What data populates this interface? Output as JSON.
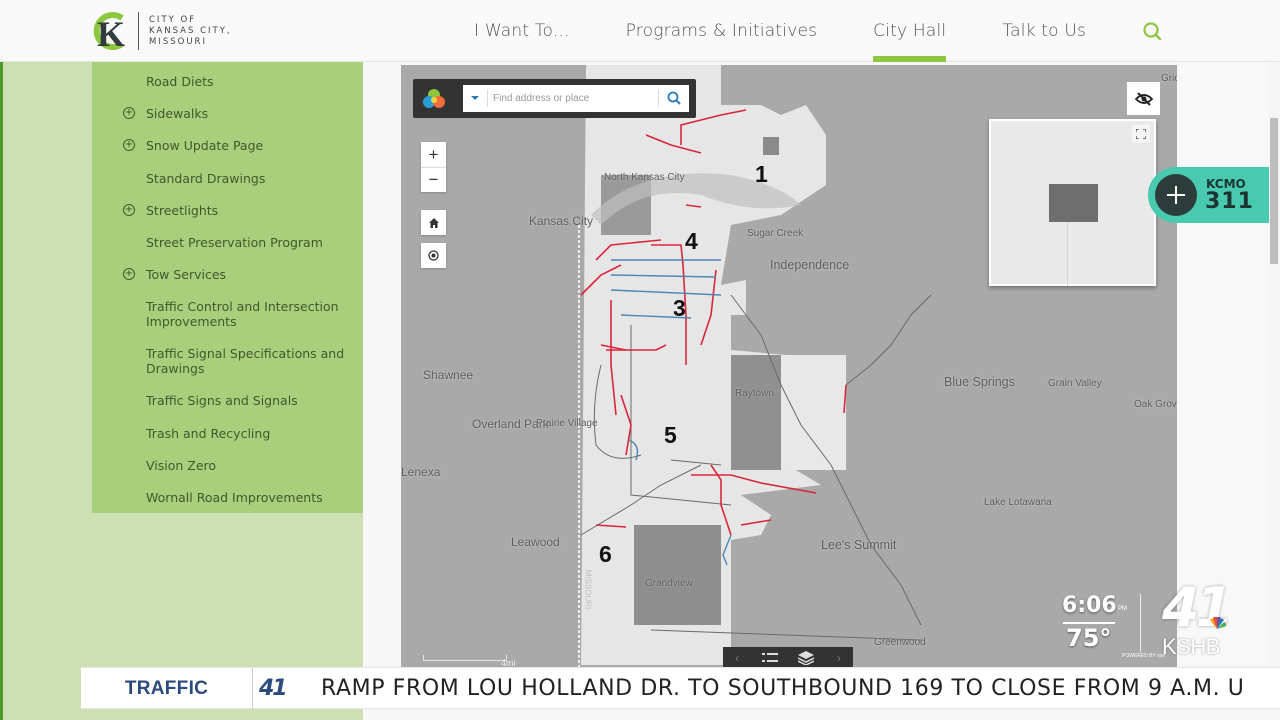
{
  "header": {
    "logo_lines": [
      "CITY OF",
      "KANSAS CITY,",
      "MISSOURI"
    ],
    "nav": [
      {
        "label": "I Want To...",
        "active": false
      },
      {
        "label": "Programs & Initiatives",
        "active": false
      },
      {
        "label": "City Hall",
        "active": true
      },
      {
        "label": "Talk to Us",
        "active": false
      }
    ],
    "search_icon": "search-icon",
    "accent_color": "#8dc63f"
  },
  "sidebar": {
    "items": [
      {
        "label": "Road Diets",
        "expandable": false
      },
      {
        "label": "Sidewalks",
        "expandable": true
      },
      {
        "label": "Snow Update Page",
        "expandable": true
      },
      {
        "label": "Standard Drawings",
        "expandable": false
      },
      {
        "label": "Streetlights",
        "expandable": true
      },
      {
        "label": "Street Preservation Program",
        "expandable": false
      },
      {
        "label": "Tow Services",
        "expandable": true
      },
      {
        "label": "Traffic Control and Intersection Improvements",
        "expandable": false
      },
      {
        "label": "Traffic Signal Specifications and Drawings",
        "expandable": false
      },
      {
        "label": "Traffic Signs and Signals",
        "expandable": false
      },
      {
        "label": "Trash and Recycling",
        "expandable": false
      },
      {
        "label": "Vision Zero",
        "expandable": false
      },
      {
        "label": "Wornall Road Improvements",
        "expandable": false
      }
    ],
    "expand_icon": "plus-circle-icon"
  },
  "map": {
    "search": {
      "placeholder": "Find address or place"
    },
    "controls": {
      "zoom_in": "+",
      "zoom_out": "−",
      "home": "home-icon",
      "locate": "locate-icon"
    },
    "scale_label": "4mi",
    "place_labels": [
      {
        "name": "North Kansas City"
      },
      {
        "name": "Kansas City"
      },
      {
        "name": "Sugar Creek"
      },
      {
        "name": "Independence"
      },
      {
        "name": "Shawnee"
      },
      {
        "name": "Overland Park"
      },
      {
        "name": "Prairie Village"
      },
      {
        "name": "Lenexa"
      },
      {
        "name": "Raytown"
      },
      {
        "name": "Blue Springs"
      },
      {
        "name": "Grain Valley"
      },
      {
        "name": "Oak Grove"
      },
      {
        "name": "Lake Lotawana"
      },
      {
        "name": "Leawood"
      },
      {
        "name": "Lee's Summit"
      },
      {
        "name": "Grandview"
      },
      {
        "name": "Greenwood"
      },
      {
        "name": "Gridley"
      },
      {
        "name": "MISSOURI"
      }
    ],
    "districts": [
      "1",
      "4",
      "3",
      "5",
      "6"
    ],
    "powered_by": "POWERED BY esri",
    "line_colors": {
      "red": "#d9263a",
      "blue": "#4b86b4"
    }
  },
  "kcmo311": {
    "top": "KCMO",
    "bottom": "311",
    "color": "#48c9b0"
  },
  "broadcast": {
    "time": "6:06",
    "ampm": "PM",
    "temperature": "75°",
    "station_number": "41",
    "station_call": "KSHB",
    "ticker_label": "TRAFFIC",
    "ticker_logo": "41",
    "ticker_text": "RAMP FROM LOU HOLLAND DR. TO SOUTHBOUND 169 TO CLOSE FROM 9 A.M. U"
  }
}
